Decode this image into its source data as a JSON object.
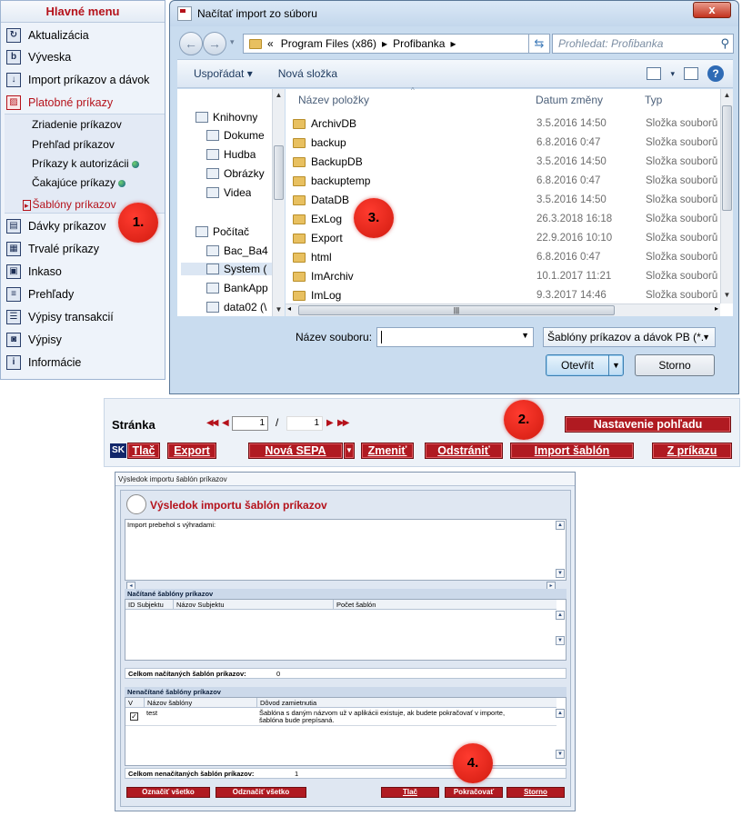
{
  "menu": {
    "title": "Hlavné menu",
    "items": [
      {
        "label": "Aktualizácia"
      },
      {
        "label": "Výveska"
      },
      {
        "label": "Import príkazov a dávok"
      },
      {
        "label": "Platobné príkazy"
      },
      {
        "label": "Dávky príkazov"
      },
      {
        "label": "Trvalé príkazy"
      },
      {
        "label": "Inkaso"
      },
      {
        "label": "Prehľady"
      },
      {
        "label": "Výpisy transakcií"
      },
      {
        "label": "Výpisy"
      },
      {
        "label": "Informácie"
      }
    ],
    "subitems": [
      {
        "label": "Zriadenie príkazov"
      },
      {
        "label": "Prehľad príkazov"
      },
      {
        "label": "Príkazy k autorizácii"
      },
      {
        "label": "Čakajúce príkazy"
      },
      {
        "label": "Šablóny príkazov"
      }
    ]
  },
  "markers": {
    "m1": "1.",
    "m2": "2.",
    "m3": "3.",
    "m4": "4."
  },
  "dialog": {
    "title": "Načítať import zo súboru",
    "close": "x",
    "address": {
      "prefix": "«",
      "crumbs": [
        "Program Files (x86)",
        "Profibanka"
      ],
      "sep": "▸"
    },
    "search_placeholder": "Prohledat: Profibanka",
    "toolbar": {
      "organize": "Uspořádat ▾",
      "new_folder": "Nová složka"
    },
    "tree": [
      {
        "label": "Knihovny"
      },
      {
        "label": "Dokume"
      },
      {
        "label": "Hudba"
      },
      {
        "label": "Obrázky"
      },
      {
        "label": "Videa"
      },
      {
        "label": "Počítač"
      },
      {
        "label": "Bac_Ba4"
      },
      {
        "label": "System ("
      },
      {
        "label": "BankApp"
      },
      {
        "label": "data02 (\\"
      }
    ],
    "columns": {
      "name": "Název položky",
      "date": "Datum změny",
      "type": "Typ"
    },
    "files": [
      {
        "name": "ArchivDB",
        "date": "3.5.2016 14:50",
        "type": "Složka souborů"
      },
      {
        "name": "backup",
        "date": "6.8.2016 0:47",
        "type": "Složka souborů"
      },
      {
        "name": "BackupDB",
        "date": "3.5.2016 14:50",
        "type": "Složka souborů"
      },
      {
        "name": "backuptemp",
        "date": "6.8.2016 0:47",
        "type": "Složka souborů"
      },
      {
        "name": "DataDB",
        "date": "3.5.2016 14:50",
        "type": "Složka souborů"
      },
      {
        "name": "ExLog",
        "date": "26.3.2018 16:18",
        "type": "Složka souborů"
      },
      {
        "name": "Export",
        "date": "22.9.2016 10:10",
        "type": "Složka souborů"
      },
      {
        "name": "html",
        "date": "6.8.2016 0:47",
        "type": "Složka souborů"
      },
      {
        "name": "ImArchiv",
        "date": "10.1.2017 11:21",
        "type": "Složka souborů"
      },
      {
        "name": "ImLog",
        "date": "9.3.2017 14:46",
        "type": "Složka souborů"
      }
    ],
    "filename_label": "Název souboru:",
    "filename_value": "",
    "filetype": "Šablóny príkazov a dávok PB (*.",
    "open_btn": "Otevřít",
    "cancel_btn": "Storno"
  },
  "strip": {
    "page_label": "Stránka",
    "page_current": "1",
    "page_sep": "/",
    "page_total": "1",
    "view_settings": "Nastavenie pohľadu",
    "lang": "SK",
    "buttons": {
      "print": "Tlač",
      "export": "Export",
      "new_sepa": "Nová SEPA",
      "change": "Zmeniť",
      "remove": "Odstrániť",
      "import_templates": "Import šablón",
      "from_order": "Z príkazu"
    }
  },
  "result": {
    "window_title": "Výsledok importu šablón príkazov",
    "heading": "Výsledok importu šablón príkazov",
    "message": "Import prebehol s výhradami:",
    "loaded_header": "Načítané šablóny príkazov",
    "loaded_columns": [
      "ID Subjektu",
      "Názov Subjektu",
      "Počet šablón"
    ],
    "loaded_total_label": "Celkom načítaných šablón príkazov:",
    "loaded_total": "0",
    "notloaded_header": "Nenačítané šablóny príkazov",
    "notloaded_columns": [
      "V",
      "Názov šablóny",
      "Dôvod zamietnutia"
    ],
    "notloaded_rows": [
      {
        "checked": "✓",
        "name": "test",
        "reason_line1": "Šablóna s daným názvom už v aplikácii existuje, ak budete pokračovať v importe,",
        "reason_line2": "šablóna bude prepísaná."
      }
    ],
    "notloaded_total_label": "Celkom nenačítaných šablón príkazov:",
    "notloaded_total": "1",
    "buttons": {
      "select_all": "Označiť všetko",
      "deselect_all": "Odznačiť všetko",
      "print": "Tlač",
      "continue": "Pokračovať",
      "cancel": "Storno"
    }
  }
}
